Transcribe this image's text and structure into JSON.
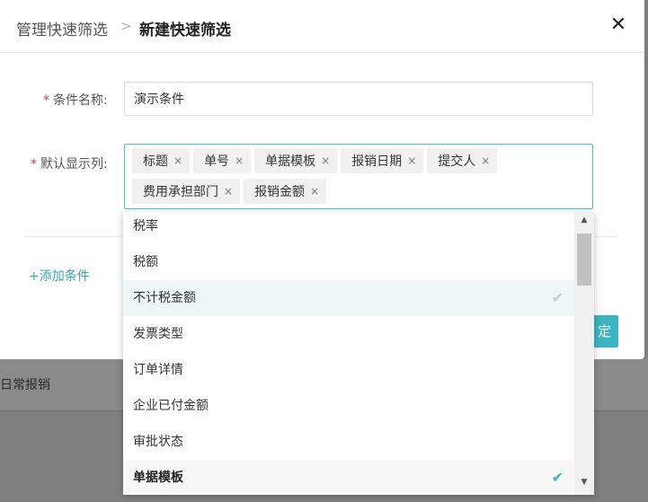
{
  "header": {
    "breadcrumb_parent": "管理快速筛选",
    "breadcrumb_separator": ">",
    "breadcrumb_current": "新建快速筛选",
    "close_glyph": "✕"
  },
  "form": {
    "name_label": "条件名称:",
    "name_value": "演示条件",
    "columns_label": "默认显示列:",
    "required_mark": "*",
    "tags": [
      "标题",
      "单号",
      "单据模板",
      "报销日期",
      "提交人",
      "费用承担部门",
      "报销金额"
    ],
    "tag_remove_glyph": "×"
  },
  "actions": {
    "add_condition": "+添加条件",
    "confirm_partial": "定"
  },
  "background": {
    "row_text": "日常报销"
  },
  "dropdown": {
    "options": [
      {
        "label": "税率",
        "checked": false,
        "state": "normal"
      },
      {
        "label": "税额",
        "checked": false,
        "state": "normal"
      },
      {
        "label": "不计税金额",
        "checked": true,
        "state": "hover"
      },
      {
        "label": "发票类型",
        "checked": false,
        "state": "normal"
      },
      {
        "label": "订单详情",
        "checked": false,
        "state": "normal"
      },
      {
        "label": "企业已付金额",
        "checked": false,
        "state": "normal"
      },
      {
        "label": "审批状态",
        "checked": false,
        "state": "normal"
      },
      {
        "label": "单据模板",
        "checked": true,
        "state": "selected"
      }
    ],
    "check_glyph": "✔",
    "scroll_up_glyph": "▲",
    "scroll_down_glyph": "▼"
  },
  "colors": {
    "accent": "#3ab6c2",
    "required": "#e4393c"
  }
}
